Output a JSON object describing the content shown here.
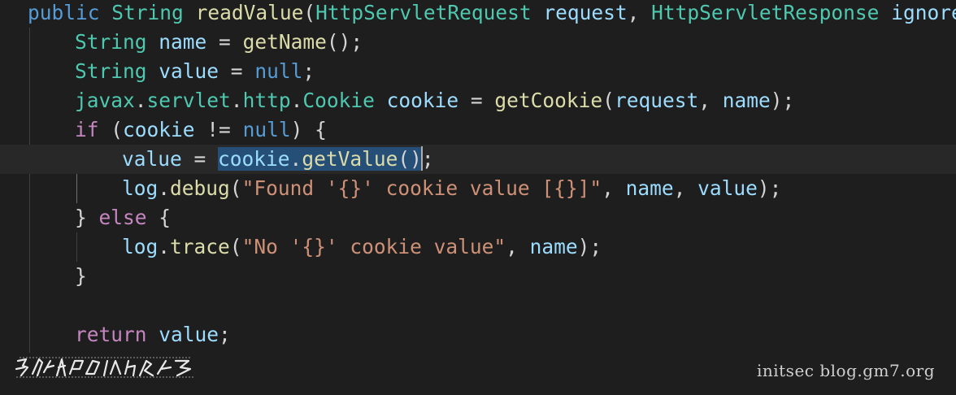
{
  "code": {
    "lines": [
      {
        "tokens": [
          {
            "t": "public",
            "c": "k"
          },
          {
            "t": " ",
            "c": "p"
          },
          {
            "t": "String",
            "c": "t"
          },
          {
            "t": " ",
            "c": "p"
          },
          {
            "t": "readValue",
            "c": "f"
          },
          {
            "t": "(",
            "c": "p"
          },
          {
            "t": "HttpServletRequest",
            "c": "t"
          },
          {
            "t": " ",
            "c": "p"
          },
          {
            "t": "request",
            "c": "v"
          },
          {
            "t": ", ",
            "c": "p"
          },
          {
            "t": "HttpServletResponse",
            "c": "t"
          },
          {
            "t": " ",
            "c": "p"
          },
          {
            "t": "ignored",
            "c": "v"
          }
        ]
      },
      {
        "tokens": [
          {
            "t": "String",
            "c": "t"
          },
          {
            "t": " ",
            "c": "p"
          },
          {
            "t": "name",
            "c": "v"
          },
          {
            "t": " = ",
            "c": "p"
          },
          {
            "t": "getName",
            "c": "f"
          },
          {
            "t": "();",
            "c": "p"
          }
        ]
      },
      {
        "tokens": [
          {
            "t": "String",
            "c": "t"
          },
          {
            "t": " ",
            "c": "p"
          },
          {
            "t": "value",
            "c": "v"
          },
          {
            "t": " = ",
            "c": "p"
          },
          {
            "t": "null",
            "c": "k"
          },
          {
            "t": ";",
            "c": "p"
          }
        ]
      },
      {
        "tokens": [
          {
            "t": "javax",
            "c": "t"
          },
          {
            "t": ".",
            "c": "p"
          },
          {
            "t": "servlet",
            "c": "t"
          },
          {
            "t": ".",
            "c": "p"
          },
          {
            "t": "http",
            "c": "t"
          },
          {
            "t": ".",
            "c": "p"
          },
          {
            "t": "Cookie",
            "c": "t"
          },
          {
            "t": " ",
            "c": "p"
          },
          {
            "t": "cookie",
            "c": "v"
          },
          {
            "t": " = ",
            "c": "p"
          },
          {
            "t": "getCookie",
            "c": "f"
          },
          {
            "t": "(",
            "c": "p"
          },
          {
            "t": "request",
            "c": "v"
          },
          {
            "t": ", ",
            "c": "p"
          },
          {
            "t": "name",
            "c": "v"
          },
          {
            "t": ");",
            "c": "p"
          }
        ]
      },
      {
        "tokens": [
          {
            "t": "if",
            "c": "c"
          },
          {
            "t": " (",
            "c": "p"
          },
          {
            "t": "cookie",
            "c": "v"
          },
          {
            "t": " != ",
            "c": "p"
          },
          {
            "t": "null",
            "c": "k"
          },
          {
            "t": ") {",
            "c": "p"
          }
        ]
      },
      {
        "tokens": [
          {
            "t": "value",
            "c": "v"
          },
          {
            "t": " = ",
            "c": "p"
          },
          {
            "t": "cookie",
            "c": "v",
            "sel": true
          },
          {
            "t": ".",
            "c": "p",
            "sel": true
          },
          {
            "t": "getValue",
            "c": "f",
            "sel": true
          },
          {
            "t": "()",
            "c": "p",
            "sel": true
          },
          {
            "t": "",
            "c": "cursor"
          },
          {
            "t": ";",
            "c": "p"
          }
        ]
      },
      {
        "tokens": [
          {
            "t": "log",
            "c": "v"
          },
          {
            "t": ".",
            "c": "p"
          },
          {
            "t": "debug",
            "c": "f"
          },
          {
            "t": "(",
            "c": "p"
          },
          {
            "t": "\"Found '{}' cookie value [{}]\"",
            "c": "s"
          },
          {
            "t": ", ",
            "c": "p"
          },
          {
            "t": "name",
            "c": "v"
          },
          {
            "t": ", ",
            "c": "p"
          },
          {
            "t": "value",
            "c": "v"
          },
          {
            "t": ");",
            "c": "p"
          }
        ]
      },
      {
        "tokens": [
          {
            "t": "} ",
            "c": "p"
          },
          {
            "t": "else",
            "c": "c"
          },
          {
            "t": " {",
            "c": "p"
          }
        ]
      },
      {
        "tokens": [
          {
            "t": "log",
            "c": "v"
          },
          {
            "t": ".",
            "c": "p"
          },
          {
            "t": "trace",
            "c": "f"
          },
          {
            "t": "(",
            "c": "p"
          },
          {
            "t": "\"No '{}' cookie value\"",
            "c": "s"
          },
          {
            "t": ", ",
            "c": "p"
          },
          {
            "t": "name",
            "c": "v"
          },
          {
            "t": ");",
            "c": "p"
          }
        ]
      },
      {
        "tokens": [
          {
            "t": "}",
            "c": "p"
          }
        ]
      },
      {
        "tokens": []
      },
      {
        "tokens": [
          {
            "t": "return",
            "c": "c"
          },
          {
            "t": " ",
            "c": "p"
          },
          {
            "t": "value",
            "c": "v"
          },
          {
            "t": ";",
            "c": "p"
          }
        ]
      }
    ]
  },
  "watermark": {
    "site": "initsec blog.gm7.org"
  },
  "colors": {
    "background": "#1e1e1e",
    "current_line": "#282828",
    "selection": "#264f78"
  }
}
